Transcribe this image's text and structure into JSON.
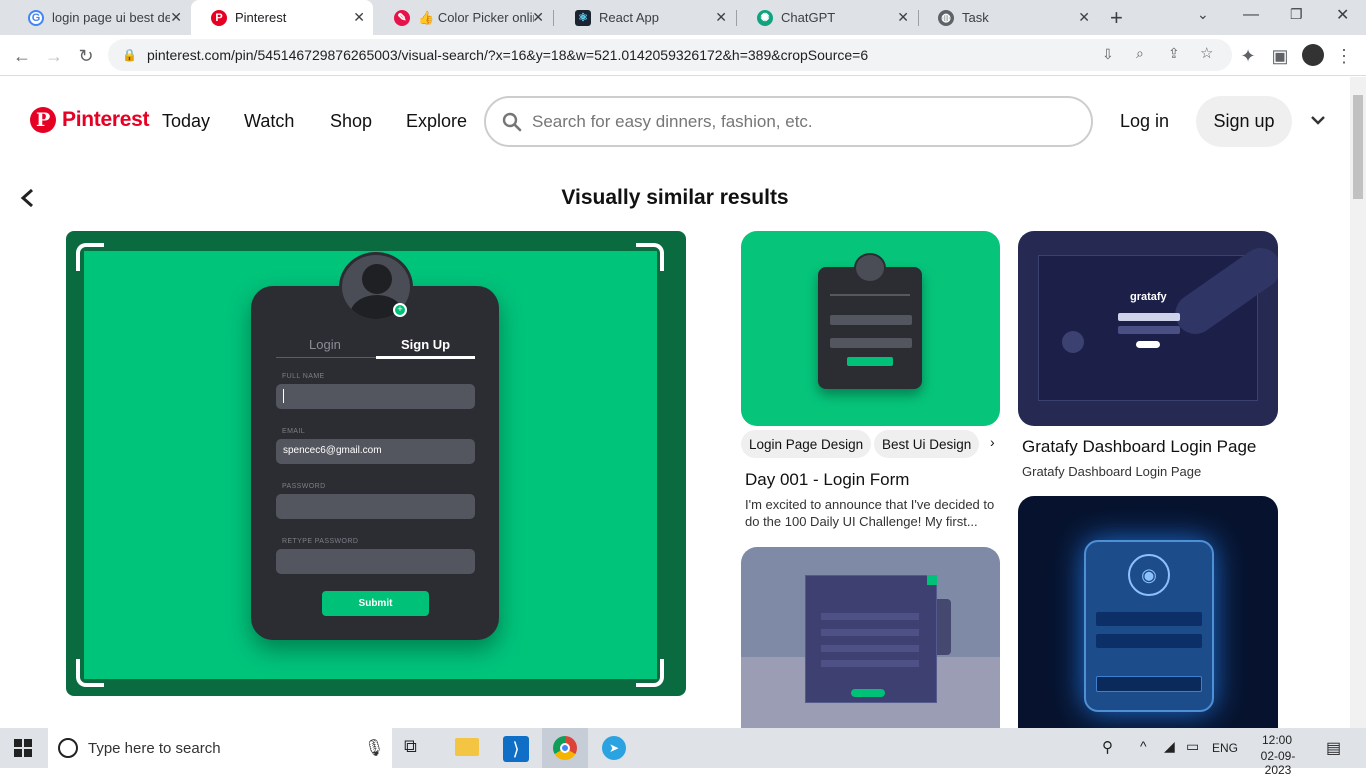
{
  "browser": {
    "tabs": [
      {
        "title": "login page ui best des",
        "favicon": "google-icon"
      },
      {
        "title": "Pinterest",
        "favicon": "pinterest-icon",
        "active": true
      },
      {
        "title": "Color Picker online",
        "favicon": "color-picker-icon"
      },
      {
        "title": "React App",
        "favicon": "react-icon"
      },
      {
        "title": "ChatGPT",
        "favicon": "chatgpt-icon"
      },
      {
        "title": "Task",
        "favicon": "globe-icon"
      }
    ],
    "url": "pinterest.com/pin/545146729876265003/visual-search/?x=16&y=18&w=521.0142059326172&h=389&cropSource=6"
  },
  "header": {
    "logo": "Pinterest",
    "nav": [
      "Today",
      "Watch",
      "Shop",
      "Explore"
    ],
    "search_placeholder": "Search for easy dinners, fashion, etc.",
    "login": "Log in",
    "signup": "Sign up"
  },
  "main": {
    "heading": "Visually similar results",
    "mockup": {
      "tab_login": "Login",
      "tab_signup": "Sign Up",
      "fields": [
        {
          "label": "FULL NAME",
          "value": ""
        },
        {
          "label": "EMAIL",
          "value": "spencec6@gmail.com"
        },
        {
          "label": "PASSWORD",
          "value": ""
        },
        {
          "label": "RETYPE PASSWORD",
          "value": ""
        }
      ],
      "submit": "Submit"
    },
    "pins": [
      {
        "chips": [
          "Login Page Design",
          "Best Ui Design"
        ],
        "title": "Day 001 - Login Form",
        "description": "I'm excited to announce that I've decided to do the 100 Daily UI Challenge! My first..."
      },
      {
        "title": "Gratafy Dashboard Login Page",
        "description": "Gratafy Dashboard Login Page",
        "image_text": "gratafy"
      }
    ]
  },
  "taskbar": {
    "search_placeholder": "Type here to search",
    "language": "ENG",
    "time": "12:00",
    "date": "02-09-2023"
  },
  "colors": {
    "pinterest_red": "#e60023",
    "mockup_green": "#01c47b",
    "mockup_dark_green": "#0a6b40",
    "card_dark": "#2c2d33"
  }
}
